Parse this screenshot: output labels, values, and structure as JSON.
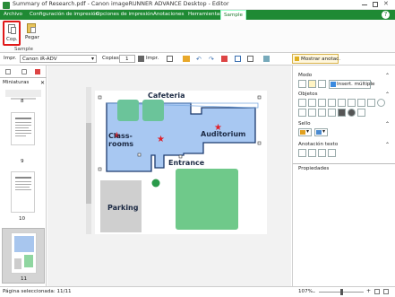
{
  "window": {
    "title": "Summary of Research.pdf - Canon imageRUNNER ADVANCE Desktop - Editor",
    "help_glyph": "?"
  },
  "ribbon_tabs": [
    "Archivo",
    "Configuración de impresión",
    "Opciones de impresión",
    "Anotaciones",
    "Herramientas",
    "Sample"
  ],
  "ribbon": {
    "copy_label": "Cop.",
    "paste_label": "Pegar",
    "group_label": "Sample"
  },
  "toolbar": {
    "printer_label": "Impr.",
    "printer_value": "Canon iR-ADV",
    "copies_label": "Copias",
    "copies_value": "1",
    "print_label": "Impr.",
    "show_annotations_label": "Mostrar anotac."
  },
  "left_pane": {
    "title": "Miniaturas",
    "pages": [
      "8",
      "9",
      "10",
      "11"
    ]
  },
  "map": {
    "cafeteria": "Cafeteria",
    "classrooms": "Class-\nrooms",
    "auditorium": "Auditorium",
    "entrance": "Entrance",
    "parking": "Parking"
  },
  "right_pane": {
    "mode_title": "Modo",
    "insert_multiple_label": "Insert. múltiple",
    "objects_title": "Objetos",
    "stamp_title": "Sello",
    "text_annotation_title": "Anotación texto",
    "properties_title": "Propiedades"
  },
  "status": {
    "page_selected": "Página seleccionada: 11/11",
    "zoom": "107%"
  }
}
